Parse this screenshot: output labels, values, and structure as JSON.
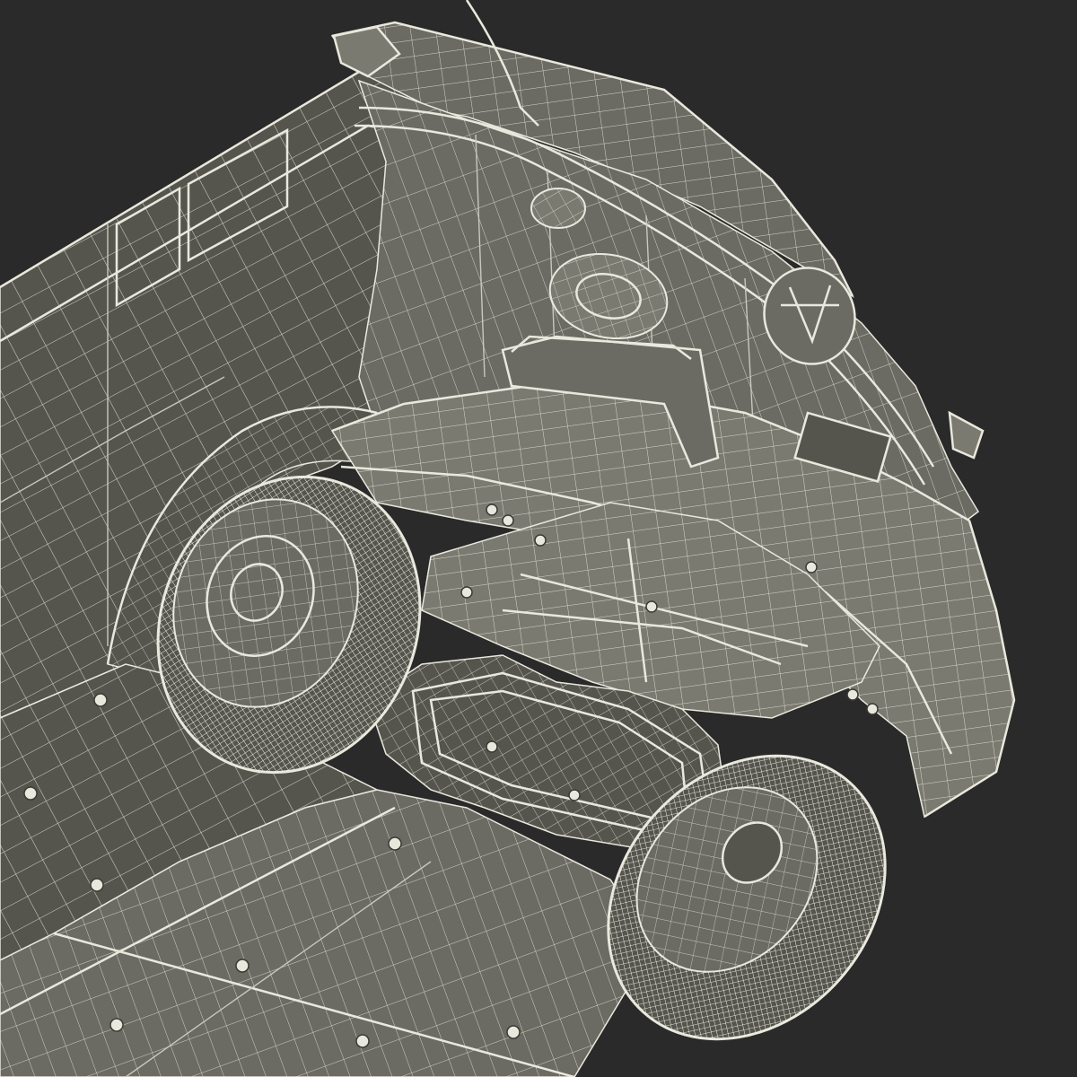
{
  "scene": {
    "subject": "wireframe-vehicle-underside",
    "colors": {
      "background": "#2a2a2a",
      "body_fill": "#6b6b63",
      "body_fill_dark": "#55554e",
      "body_fill_light": "#7a7a71",
      "wire": "#e9e8dd",
      "wire_dim": "#c9c8bc",
      "shadow": "#3a3a36"
    },
    "icons": {
      "tire": "tire-icon",
      "wheel_hub": "hub-icon",
      "bolt": "bolt-icon",
      "antenna": "antenna-icon"
    }
  }
}
